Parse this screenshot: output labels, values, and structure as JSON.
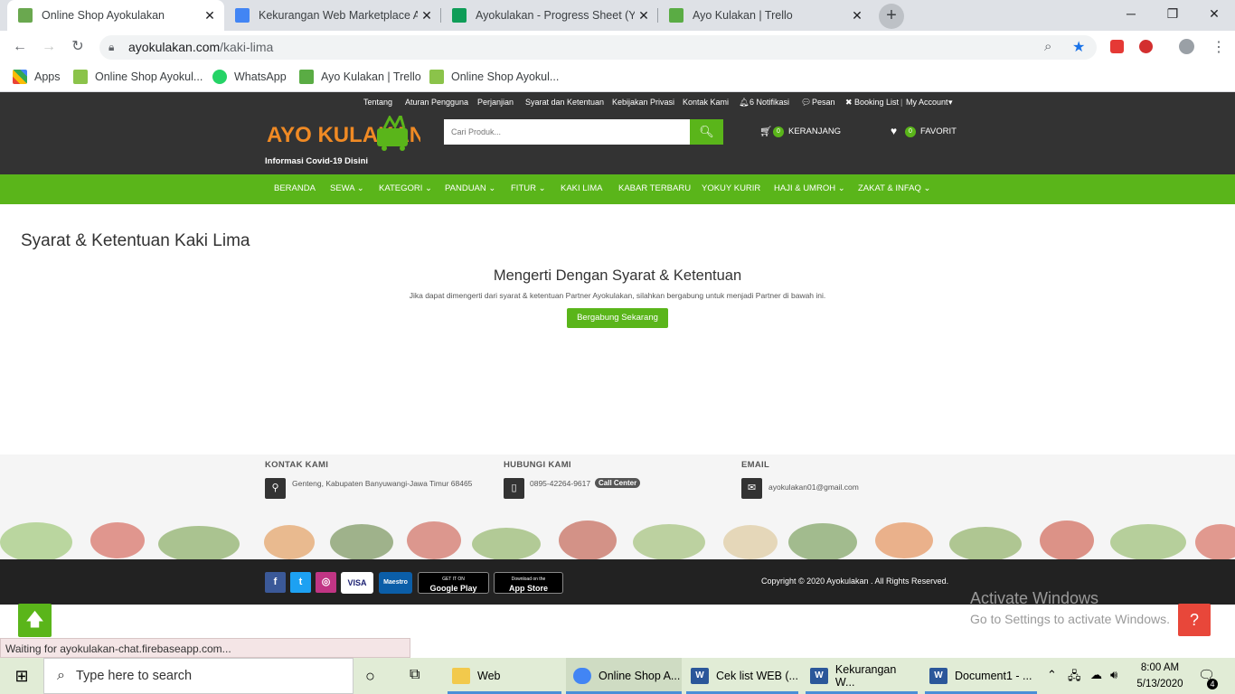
{
  "browser": {
    "tabs": [
      {
        "title": "Online Shop Ayokulakan",
        "active": true,
        "favicon_color": "#6aa84f"
      },
      {
        "title": "Kekurangan Web Marketplace A",
        "active": false,
        "favicon_color": "#4285f4"
      },
      {
        "title": "Ayokulakan - Progress Sheet (Yu",
        "active": false,
        "favicon_color": "#0f9d58"
      },
      {
        "title": "Ayo Kulakan | Trello",
        "active": false,
        "favicon_color": "#5aac44"
      }
    ],
    "new_tab": "+",
    "window_controls": {
      "minimize": "─",
      "restore": "❐",
      "close": "✕"
    },
    "url_domain": "ayokulakan.com",
    "url_path": "/kaki-lima",
    "bookmarks": [
      {
        "label": "Apps"
      },
      {
        "label": "Online Shop Ayokul..."
      },
      {
        "label": "WhatsApp"
      },
      {
        "label": "Ayo Kulakan | Trello"
      },
      {
        "label": "Online Shop Ayokul..."
      }
    ]
  },
  "site": {
    "top_links": [
      "Tentang",
      "Aturan Pengguna",
      "Perjanjian",
      "Syarat dan Ketentuan",
      "Kebijakan Privasi",
      "Kontak Kami",
      "6 Notifikasi",
      "Pesan",
      "Booking List",
      "My Account"
    ],
    "logo_text": "AYO KULAKAN",
    "covid_link": "Informasi Covid-19 Disini",
    "search_placeholder": "Cari Produk...",
    "cart_count": "0",
    "cart_label": "KERANJANG",
    "fav_count": "0",
    "fav_label": "FAVORIT",
    "nav": [
      "BERANDA",
      "SEWA",
      "KATEGORI",
      "PANDUAN",
      "FITUR",
      "KAKI LIMA",
      "KABAR TERBARU",
      "YOKUY KURIR",
      "HAJI & UMROH",
      "ZAKAT & INFAQ"
    ],
    "nav_dropdown": [
      false,
      true,
      true,
      true,
      true,
      false,
      false,
      false,
      true,
      true
    ]
  },
  "content": {
    "page_title": "Syarat & Ketentuan Kaki Lima",
    "heading": "Mengerti Dengan Syarat & Ketentuan",
    "description": "Jika dapat dimengerti dari syarat & ketentuan Partner Ayokulakan, silahkan bergabung untuk menjadi Partner di bawah ini.",
    "join_button": "Bergabung Sekarang"
  },
  "footer": {
    "contact_heading": "KONTAK KAMI",
    "address": "Genteng, Kabupaten Banyuwangi-Jawa Timur 68465",
    "call_heading": "HUBUNGI KAMI",
    "phone": "0895-42264-9617",
    "call_badge": "Call Center",
    "email_heading": "EMAIL",
    "email": "ayokulakan01@gmail.com",
    "payments": [
      "VISA",
      "Maestro",
      "Google Play",
      "App Store"
    ],
    "google_play_small": "GET IT ON",
    "app_store_small": "Download on the",
    "copyright": "Copyright © 2020 Ayokulakan . All Rights Reserved."
  },
  "overlay": {
    "activate_title": "Activate Windows",
    "activate_sub": "Go to Settings to activate Windows.",
    "status_text": "Waiting for ayokulakan-chat.firebaseapp.com..."
  },
  "taskbar": {
    "search_placeholder": "Type here to search",
    "items": [
      {
        "label": "Web"
      },
      {
        "label": "Online Shop A..."
      },
      {
        "label": "Cek list WEB (..."
      },
      {
        "label": "Kekurangan W..."
      },
      {
        "label": "Document1 - ..."
      }
    ],
    "time": "8:00 AM",
    "date": "5/13/2020",
    "notification_count": "4"
  },
  "colors": {
    "accent_green": "#5ab51a",
    "header_dark": "#333333",
    "help_red": "#e8473a"
  }
}
